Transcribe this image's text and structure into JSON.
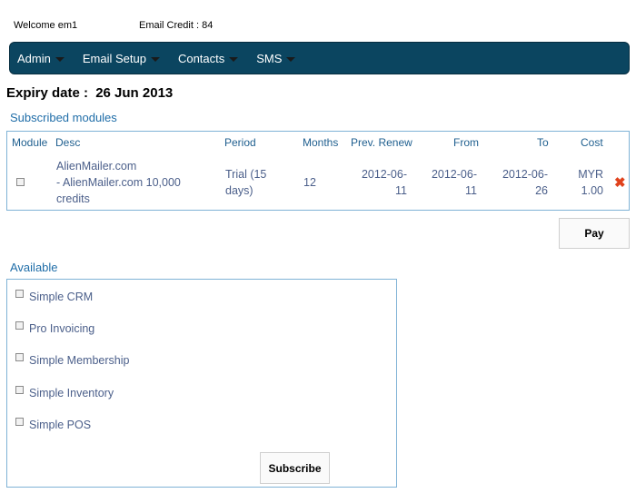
{
  "header": {
    "welcome": "Welcome em1",
    "email_credit": "Email Credit : 84"
  },
  "nav": {
    "items": [
      "Admin",
      "Email Setup",
      "Contacts",
      "SMS"
    ]
  },
  "expiry": {
    "label": "Expiry date :",
    "date": "26 Jun 2013"
  },
  "subscribed": {
    "title": "Subscribed modules",
    "columns": {
      "module": "Module",
      "desc": "Desc",
      "period": "Period",
      "months": "Months",
      "prev_renew": "Prev. Renew",
      "from": "From",
      "to": "To",
      "cost": "Cost"
    },
    "row": {
      "desc_line1": "AlienMailer.com",
      "desc_line2": "- AlienMailer.com 10,000",
      "desc_line3": "credits",
      "period_line1": "Trial (15",
      "period_line2": "days)",
      "months": "12",
      "prev_renew_line1": "2012-06-",
      "prev_renew_line2": "11",
      "from_line1": "2012-06-",
      "from_line2": "11",
      "to_line1": "2012-06-",
      "to_line2": "26",
      "cost_line1": "MYR",
      "cost_line2": "1.00",
      "remove_icon": "close-icon",
      "checked": false
    },
    "pay_label": "Pay"
  },
  "available": {
    "title": "Available",
    "items": [
      "Simple CRM",
      "Pro Invoicing",
      "Simple Membership",
      "Simple Inventory",
      "Simple POS"
    ],
    "subscribe_label": "Subscribe"
  },
  "colors": {
    "navbar": "#0b4560",
    "link": "#1f6da8",
    "border": "#7fb2d6",
    "remove": "#e0421c"
  }
}
